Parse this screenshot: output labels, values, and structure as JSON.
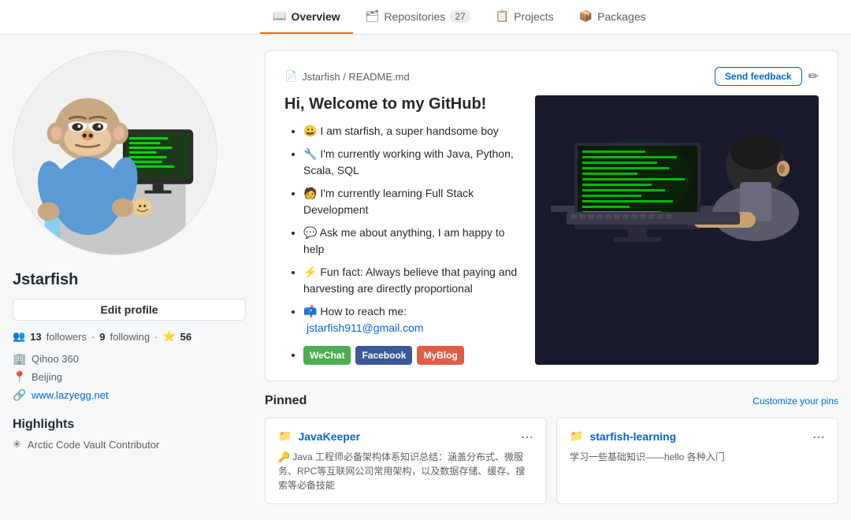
{
  "nav": {
    "tabs": [
      {
        "id": "overview",
        "icon": "📖",
        "label": "Overview",
        "active": true,
        "badge": null
      },
      {
        "id": "repositories",
        "icon": "🗂",
        "label": "Repositories",
        "active": false,
        "badge": "27"
      },
      {
        "id": "projects",
        "icon": "📋",
        "label": "Projects",
        "active": false,
        "badge": null
      },
      {
        "id": "packages",
        "icon": "📦",
        "label": "Packages",
        "active": false,
        "badge": null
      }
    ]
  },
  "sidebar": {
    "username": "Jstarfish",
    "edit_profile_label": "Edit profile",
    "followers": "13",
    "followers_label": "followers",
    "following": "9",
    "following_label": "following",
    "stars": "56",
    "stars_label": "stars",
    "meta": [
      {
        "icon": "🏢",
        "text": "Qihoo 360"
      },
      {
        "icon": "📍",
        "text": "Beijing"
      },
      {
        "icon": "🔗",
        "text": "www.lazyegg.net",
        "link": "http://www.lazyegg.net"
      }
    ],
    "highlights_title": "Highlights",
    "highlight_items": [
      {
        "icon": "✳",
        "text": "Arctic Code Vault Contributor"
      }
    ]
  },
  "readme": {
    "path": "Jstarfish / README.md",
    "send_feedback_label": "Send feedback",
    "title": "Hi,  Welcome to my GitHub!",
    "items": [
      {
        "emoji": "😀",
        "text": "I am starfish, a super handsome boy"
      },
      {
        "emoji": "🔧",
        "text": "I'm currently working with Java, Python, Scala, SQL"
      },
      {
        "emoji": "🧑‍💻",
        "text": "I'm currently learning Full Stack Development"
      },
      {
        "emoji": "💬",
        "text": "Ask me about anything, I am happy to help"
      },
      {
        "emoji": "⚡",
        "text": "Fun fact: Always believe that paying and harvesting are directly proportional"
      },
      {
        "emoji": "📫",
        "text": "How to reach me:",
        "link": "jstarfish911@gmail.com"
      }
    ],
    "badges": [
      {
        "label": "WeChat",
        "type": "wechat"
      },
      {
        "label": "Facebook",
        "type": "facebook"
      },
      {
        "label": "MyBlog",
        "type": "myblog"
      }
    ]
  },
  "pinned": {
    "title": "Pinned",
    "customize_label": "Customize your pins",
    "repos": [
      {
        "name": "JavaKeeper",
        "desc": "🔑 Java 工程师必备架构体系知识总结：涵盖分布式、微服务、RPC等互联网公司常用架构，以及数据存储、缓存、搜索等必备技能"
      },
      {
        "name": "starfish-learning",
        "desc": "学习一些基础知识——hello 各种入门"
      }
    ]
  },
  "icons": {
    "book": "📖",
    "repo": "🗂",
    "project": "📋",
    "package": "📦",
    "readme_file": "📄",
    "edit": "✏",
    "building": "🏢",
    "location": "📍",
    "link": "🔗",
    "star": "⭐",
    "users": "👥",
    "repo_small": "📁",
    "ellipsis": "⋯"
  }
}
